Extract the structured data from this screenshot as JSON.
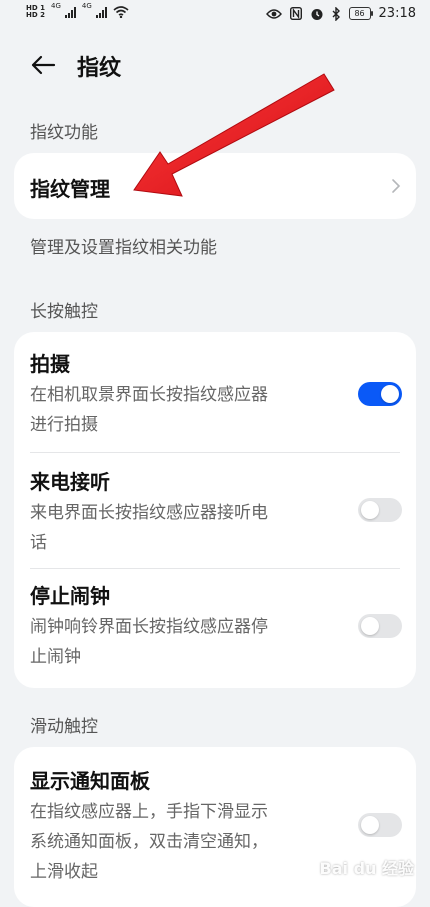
{
  "status_bar": {
    "sim_labels": [
      "HD 1",
      "HD 2"
    ],
    "network_label": "4G",
    "battery": "86",
    "time": "23:18",
    "icons": [
      "eye-icon",
      "nfc-icon",
      "alarm-icon",
      "bluetooth-icon",
      "battery-icon",
      "wifi-icon"
    ]
  },
  "header": {
    "title": "指纹",
    "back_icon": "arrow-left-icon"
  },
  "sections": {
    "fingerprint_function": "指纹功能",
    "long_press": "长按触控",
    "swipe": "滑动触控"
  },
  "fingerprint_management": {
    "label": "指纹管理",
    "description": "管理及设置指纹相关功能"
  },
  "long_press_items": [
    {
      "title": "拍摄",
      "subtitle_line1": "在相机取景界面长按指纹感应器",
      "subtitle_line2": "进行拍摄",
      "enabled": true
    },
    {
      "title": "来电接听",
      "subtitle_line1": "来电界面长按指纹感应器接听电",
      "subtitle_line2": "话",
      "enabled": false
    },
    {
      "title": "停止闹钟",
      "subtitle_line1": "闹钟响铃界面长按指纹感应器停",
      "subtitle_line2": "止闹钟",
      "enabled": false
    }
  ],
  "swipe_items": [
    {
      "title": "显示通知面板",
      "subtitle_line1": "在指纹感应器上，手指下滑显示",
      "subtitle_line2": "系统通知面板，双击清空通知，",
      "subtitle_line3": "上滑收起",
      "enabled": false
    }
  ],
  "watermark": {
    "text": "Bai du 经验"
  },
  "colors": {
    "accent": "#0a59f7",
    "annotation_arrow": "#e8131a"
  }
}
